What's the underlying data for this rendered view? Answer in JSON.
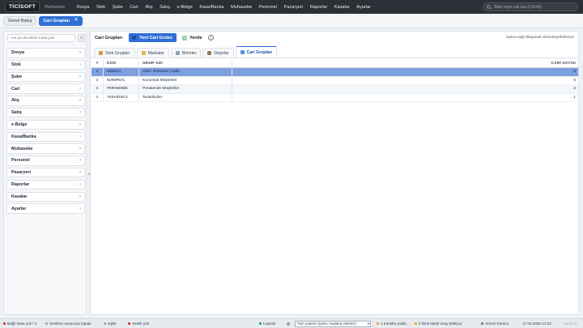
{
  "app": {
    "logo": "TİCİSOFT",
    "subtitle": "Muhasebe"
  },
  "menu": [
    "Dosya",
    "Stok",
    "Şube",
    "Cari",
    "Alış",
    "Satış",
    "e-Belge",
    "Kasa/Banka",
    "Muhasebe",
    "Personel",
    "Pazaryeri",
    "Raporlar",
    "Kasalar",
    "Ayarlar"
  ],
  "global_search": {
    "placeholder": "Stok veya cari ara (Ctrl+K)"
  },
  "tabs": {
    "home": "Genel Bakış",
    "active": "Cari Grupları"
  },
  "sidebar": {
    "search_placeholder": "Ara ya da ekran kodu yaz",
    "collapse_label": "«",
    "items": [
      "Dosya",
      "Stok",
      "Şube",
      "Cari",
      "Alış",
      "Satış",
      "e-Belge",
      "Kasa/Banka",
      "Muhasebe",
      "Personel",
      "Pazaryeri",
      "Raporlar",
      "Kasalar",
      "Ayarlar"
    ]
  },
  "main": {
    "title": "Cari Grupları",
    "new_button": "Yeni Cari Grubu",
    "refresh_button": "Yenile",
    "hint": "Satıra sağ tıklayarak düzenleyebilirsiniz",
    "subtabs": [
      "Stok Grupları",
      "Markalar",
      "Birimler",
      "Depolar",
      "Cari Grupları"
    ],
    "active_subtab": "Cari Grupları"
  },
  "table": {
    "headers": {
      "num": "#",
      "code": "KOD",
      "name": "GRUP ADI",
      "count": "CARİ SAYISI"
    },
    "rows": [
      {
        "num": "1",
        "code": "HORECA",
        "name": "Otel / Restoran / Kafe",
        "count": "5"
      },
      {
        "num": "2",
        "code": "KURUMSAL",
        "name": "Kurumsal Müşteriler",
        "count": "5"
      },
      {
        "num": "3",
        "code": "PERAKENDE",
        "name": "Perakende Müşteriler",
        "count": "2"
      },
      {
        "num": "4",
        "code": "TEDARIKCI",
        "name": "Tedarikçiler",
        "count": "1"
      }
    ]
  },
  "status": {
    "queue": "Bağlı kasa yok / 3",
    "server": "Senkron sunucusu kapalı",
    "sqlite": "sqlite",
    "backup": "Yedek yok",
    "license": "Lisanslı",
    "branch": "Tüm şubeler (Ipkes: Kadıköy Merkez)",
    "transfer": "1 transfer yolda",
    "approval": "2 ilimit talebi onay bekliyor",
    "user": "Ahmet Karaca",
    "datetime": "17.09.2026 21:20",
    "version": "v2.12.3"
  },
  "colors": {
    "accent": "#2f6fd6",
    "topbar": "#2b2f36",
    "selected_row": "#7c9fde"
  }
}
